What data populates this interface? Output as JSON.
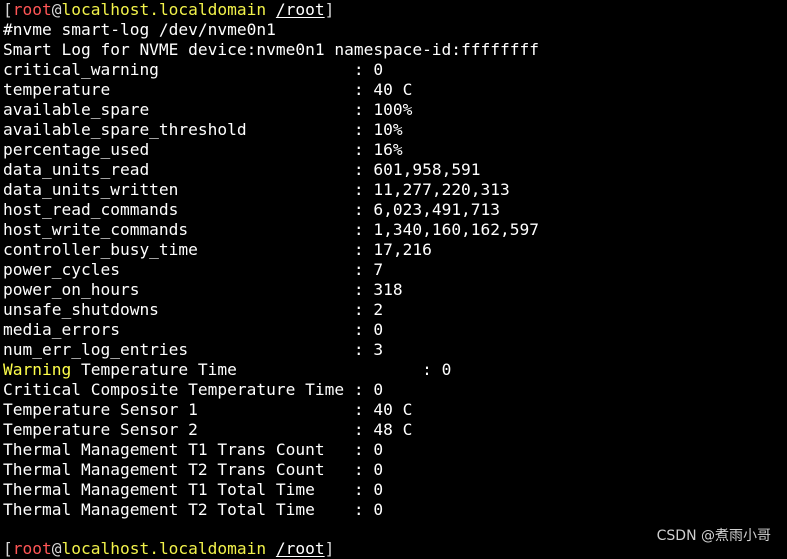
{
  "prompt": {
    "open_bracket": "[",
    "user": "root",
    "at": "@",
    "host": "localhost.localdomain",
    "space": " ",
    "path": "/root",
    "close_bracket": "]"
  },
  "command": "#nvme smart-log /dev/nvme0n1",
  "header": "Smart Log for NVME device:nvme0n1 namespace-id:ffffffff",
  "rows": [
    {
      "label": "critical_warning                    ",
      "value": ": 0"
    },
    {
      "label": "temperature                         ",
      "value": ": 40 C"
    },
    {
      "label": "available_spare                     ",
      "value": ": 100%"
    },
    {
      "label": "available_spare_threshold           ",
      "value": ": 10%"
    },
    {
      "label": "percentage_used                     ",
      "value": ": 16%"
    },
    {
      "label": "data_units_read                     ",
      "value": ": 601,958,591"
    },
    {
      "label": "data_units_written                  ",
      "value": ": 11,277,220,313"
    },
    {
      "label": "host_read_commands                  ",
      "value": ": 6,023,491,713"
    },
    {
      "label": "host_write_commands                 ",
      "value": ": 1,340,160,162,597"
    },
    {
      "label": "controller_busy_time                ",
      "value": ": 17,216"
    },
    {
      "label": "power_cycles                        ",
      "value": ": 7"
    },
    {
      "label": "power_on_hours                      ",
      "value": ": 318"
    },
    {
      "label": "unsafe_shutdowns                    ",
      "value": ": 2"
    },
    {
      "label": "media_errors                        ",
      "value": ": 0"
    },
    {
      "label": "num_err_log_entries                 ",
      "value": ": 3"
    }
  ],
  "warning_row": {
    "highlight": "Warning",
    "rest": " Temperature Time                   ",
    "value": ": 0"
  },
  "rows2": [
    {
      "label": "Critical Composite Temperature Time ",
      "value": ": 0"
    },
    {
      "label": "Temperature Sensor 1                ",
      "value": ": 40 C"
    },
    {
      "label": "Temperature Sensor 2                ",
      "value": ": 48 C"
    },
    {
      "label": "Thermal Management T1 Trans Count   ",
      "value": ": 0"
    },
    {
      "label": "Thermal Management T2 Trans Count   ",
      "value": ": 0"
    },
    {
      "label": "Thermal Management T1 Total Time    ",
      "value": ": 0"
    },
    {
      "label": "Thermal Management T2 Total Time    ",
      "value": ": 0"
    }
  ],
  "watermark": "CSDN @煮雨小哥",
  "colors": {
    "background": "#000000",
    "text": "#ffffff",
    "user": "#ff5555",
    "host": "#f2f24a",
    "warning": "#ffff4a"
  }
}
